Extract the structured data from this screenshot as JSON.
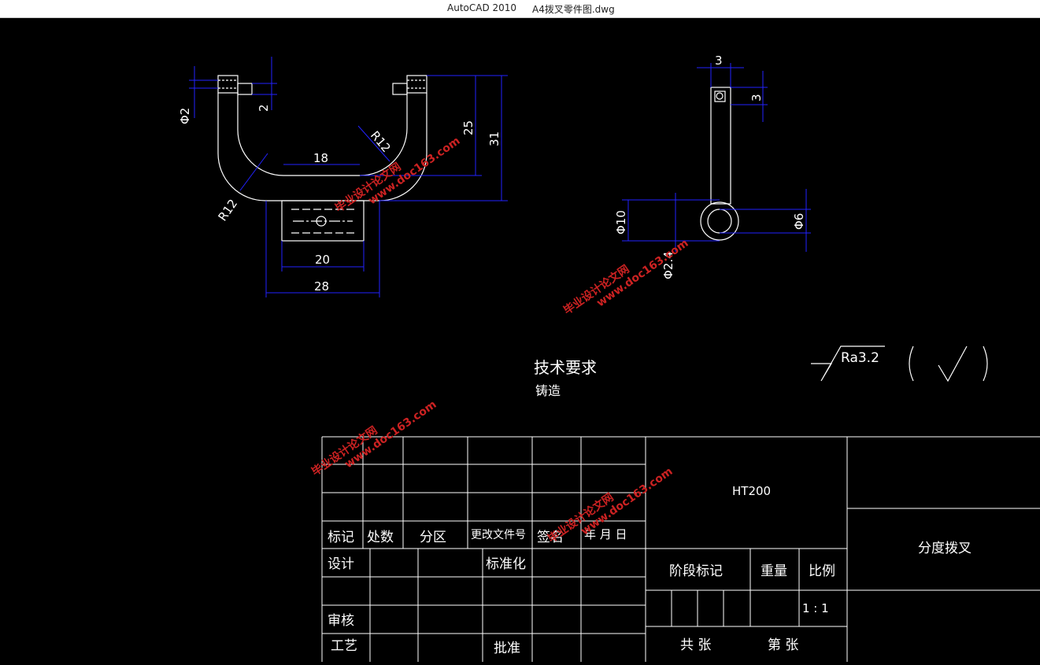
{
  "window": {
    "app": "AutoCAD 2010",
    "file": "A4拨叉零件图.dwg"
  },
  "dims": {
    "left": {
      "d2": "Φ2",
      "two": "2",
      "r12_in": "R12",
      "r12_out": "R12",
      "eighteen": "18",
      "twentyfive": "25",
      "thirtyone": "31",
      "twenty": "20",
      "twentyeight": "28"
    },
    "right": {
      "three_top": "3",
      "three_side": "3",
      "phi10": "Φ10",
      "phi6": "Φ6",
      "phi24": "Φ2.4"
    }
  },
  "notes": {
    "title": "技术要求",
    "line1": "铸造"
  },
  "roughness": {
    "value": "Ra3.2"
  },
  "titleblock": {
    "labels": [
      "标记",
      "处数",
      "分区",
      "更改文件号",
      "签名",
      "年 月 日"
    ],
    "design": "设计",
    "standard": "标准化",
    "review": "审核",
    "process": "工艺",
    "approve": "批准",
    "material": "HT200",
    "partname": "分度拨叉",
    "stage": "阶段标记",
    "weight": "重量",
    "scale_label": "比例",
    "scale": "1 : 1",
    "total": "共  张",
    "sheet": "第  张"
  },
  "watermark": {
    "line1": "毕业设计论文网",
    "line2": "www.doc163.com"
  },
  "colors": {
    "line": "#ffffff",
    "dim": "#2222ff",
    "watermark": "#cc2222",
    "bg": "#000000"
  }
}
